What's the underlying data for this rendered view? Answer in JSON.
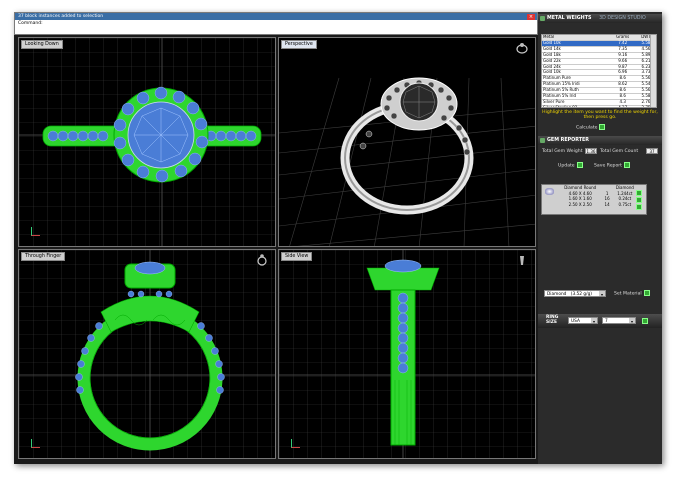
{
  "command": {
    "line1": "37 block instances added to selection",
    "line2": "Command:"
  },
  "viewports": {
    "top_left": "Looking Down",
    "top_right": "Perspective",
    "bottom_left": "Through Finger",
    "bottom_right": "Side View"
  },
  "metal_weights": {
    "title": "METAL WEIGHTS",
    "subtitle": "3D DESIGN STUDIO",
    "columns": [
      "Metal",
      "Grams",
      "DWT"
    ],
    "rows": [
      [
        "Gold 10k",
        "7.42",
        "5.58"
      ],
      [
        "Gold 14k",
        "7.35",
        "4.56"
      ],
      [
        "Gold 18k",
        "9.16",
        "5.89"
      ],
      [
        "Gold 22k",
        "9.66",
        "6.21"
      ],
      [
        "Gold 24k",
        "9.87",
        "6.23"
      ],
      [
        "Gold 10k",
        "6.96",
        "3.73"
      ],
      [
        "Platinum Pure",
        "8.6",
        "5.56"
      ],
      [
        "Platinum 15% Iridi",
        "8.62",
        "5.54"
      ],
      [
        "Platinum 5% Ruth",
        "8.6",
        "5.56"
      ],
      [
        "Platinum 5% Irid",
        "8.6",
        "5.58"
      ],
      [
        "Silver Pure",
        "4.3",
        "2.76"
      ],
      [
        "Silver Sterling 92",
        "4.27",
        "2.75"
      ],
      [
        "Palladium",
        "5.38",
        "3.48"
      ]
    ],
    "instruction": "Highlight the item you want to find the weight for, then press go.",
    "calculate_label": "Calculate"
  },
  "gem_reporter": {
    "title": "GEM REPORTER",
    "total_weight_label": "Total Gem Weight",
    "total_weight_value": "1.36",
    "total_count_label": "Total Gem Count",
    "total_count_value": "37",
    "update_label": "Update",
    "save_report_label": "Save Report",
    "columns": [
      "Diamond Round",
      "",
      "Diamond"
    ],
    "rows": [
      [
        "4.60 X 4.60",
        "1",
        "1.244ct"
      ],
      [
        "1.60 X 1.60",
        "16",
        "0.24ct"
      ],
      [
        "2.50 X 2.50",
        "14",
        "0.75ct"
      ]
    ]
  },
  "material": {
    "select_value": "Diamond",
    "select_detail": "(3.52 g/g)",
    "set_material_label": "Set Material"
  },
  "ring_size": {
    "label_line1": "RING",
    "label_line2": "SIZE",
    "standard": "USA",
    "value": "7"
  },
  "colors": {
    "wireframe_green": "#33ff33",
    "gem_blue": "#4a7dd6",
    "grid": "#3a3a3a",
    "panel_bg": "#2b2b2b",
    "accent_yellow": "#f2d600"
  }
}
